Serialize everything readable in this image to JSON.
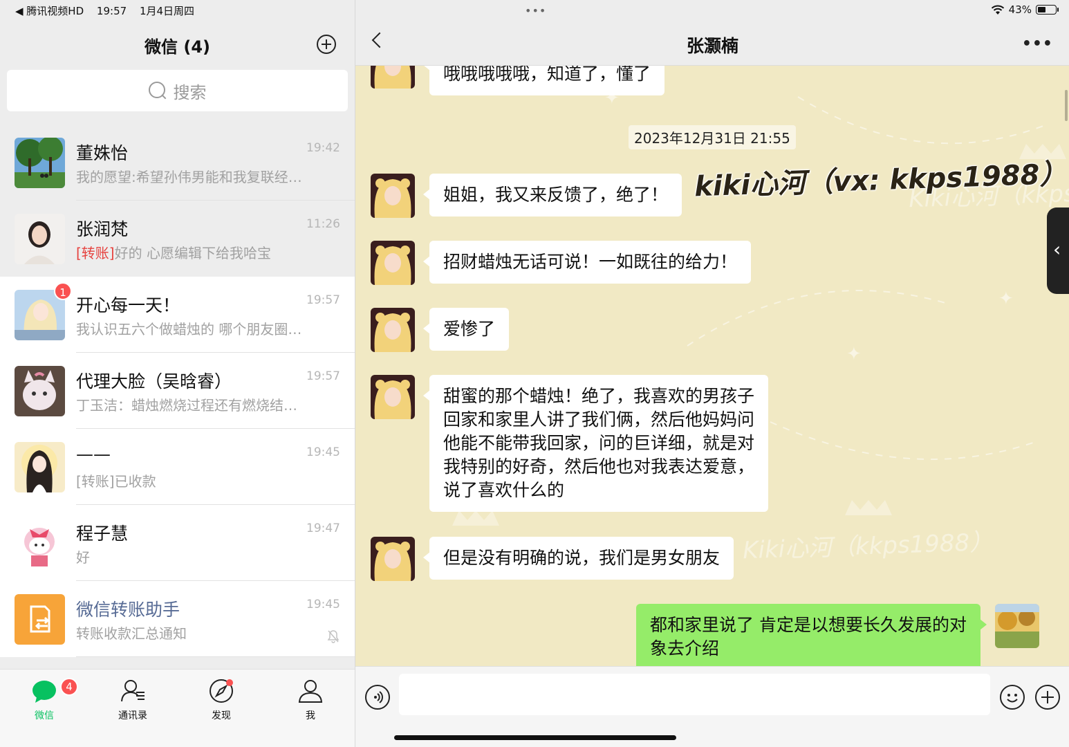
{
  "status_bar": {
    "back_app": "◀ 腾讯视频HD",
    "time": "19:57",
    "date": "1月4日周四",
    "battery": "43%",
    "multitask": "•••"
  },
  "left": {
    "title": "微信 (4)",
    "search_placeholder": "搜索",
    "chats": [
      {
        "name": "董姝怡",
        "preview": "我的愿望:希望孙伟男能和我复联经…",
        "time": "19:42",
        "pinned": true
      },
      {
        "name": "张润梵",
        "preview_tag": "[转账]",
        "preview": "好的 心愿编辑下给我哈宝",
        "time": "11:26",
        "pinned": true
      },
      {
        "name": "开心每一天！",
        "preview": "我认识五六个做蜡烛的 哪个朋友圈…",
        "time": "19:57",
        "badge": "1"
      },
      {
        "name": "代理大脸（吴晗睿）",
        "preview": "丁玉洁：蜡烛燃烧过程还有燃烧结…",
        "time": "19:57"
      },
      {
        "name": "——",
        "preview": "[转账]已收款",
        "time": "19:45"
      },
      {
        "name": "程子慧",
        "preview": "好",
        "time": "19:47"
      },
      {
        "name": "微信转账助手",
        "preview": "转账收款汇总通知",
        "time": "19:45",
        "official": true,
        "muted": true
      }
    ],
    "tabs": [
      {
        "label": "微信",
        "icon": "chat-bubble-icon",
        "badge": "4",
        "active": true
      },
      {
        "label": "通讯录",
        "icon": "contacts-icon"
      },
      {
        "label": "发现",
        "icon": "compass-icon",
        "dot": true
      },
      {
        "label": "我",
        "icon": "person-icon"
      }
    ]
  },
  "right": {
    "contact_name": "张灏楠",
    "watermark": "kiki心河（vx: kkps1988）",
    "watermark_faint": "Kiki心河（kkps1988）",
    "timestamp": "2023年12月31日 21:55",
    "partial_message": "哦哦哦哦哦，知道了，懂了",
    "messages": [
      {
        "from": "them",
        "text": "姐姐，我又来反馈了，绝了！"
      },
      {
        "from": "them",
        "text": "招财蜡烛无话可说！一如既往的给力！"
      },
      {
        "from": "them",
        "text": "爱惨了"
      },
      {
        "from": "them",
        "lines": [
          "甜蜜的那个蜡烛！绝了，我喜欢的男孩子",
          "回家和家里人讲了我们俩，然后他妈妈问",
          "他能不能带我回家，问的巨详细，就是对",
          "我特别的好奇，然后他也对我表达爱意，",
          "说了喜欢什么的"
        ]
      },
      {
        "from": "them",
        "text": "但是没有明确的说，我们是男女朋友"
      },
      {
        "from": "me",
        "lines": [
          "都和家里说了 肯定是以想要长久发展的对",
          "象去介绍"
        ]
      }
    ]
  },
  "colors": {
    "wechat_green": "#07c160",
    "my_bubble": "#95ec69",
    "chat_bg": "#f1e9c4",
    "badge_red": "#fa5151",
    "transfer_red": "#e64340"
  }
}
